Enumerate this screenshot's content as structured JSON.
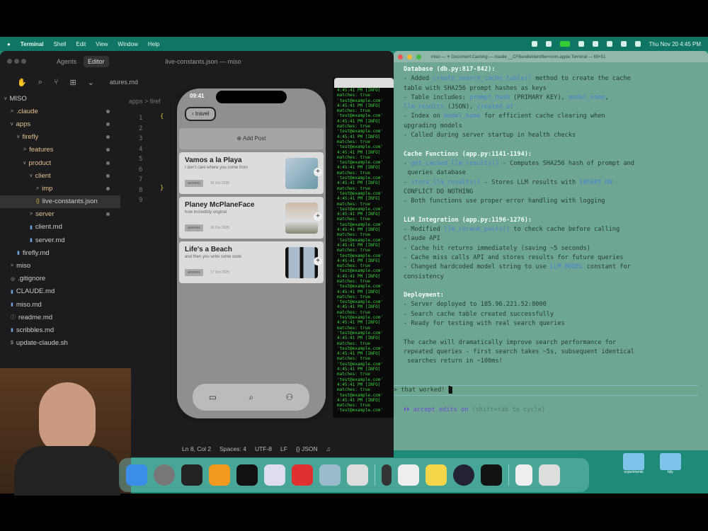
{
  "menubar": {
    "app": "Terminal",
    "items": [
      "Shell",
      "Edit",
      "View",
      "Window",
      "Help"
    ],
    "clock": "Thu Nov 20 4:45 PM"
  },
  "editor": {
    "tabs": [
      "Agents",
      "Editor"
    ],
    "title": "live-constants.json — miso",
    "open_tab": "atures.md",
    "breadcrumb": "apps > firef",
    "tree": [
      {
        "label": "MISO",
        "indent": 0,
        "icon": "v",
        "type": "root"
      },
      {
        "label": ".claude",
        "indent": 1,
        "icon": ">",
        "type": "folder"
      },
      {
        "label": "apps",
        "indent": 1,
        "icon": "v",
        "type": "folder"
      },
      {
        "label": "firefly",
        "indent": 2,
        "icon": "v",
        "type": "folder"
      },
      {
        "label": "features",
        "indent": 3,
        "icon": ">",
        "type": "folder"
      },
      {
        "label": "product",
        "indent": 3,
        "icon": "v",
        "type": "folder"
      },
      {
        "label": "client",
        "indent": 4,
        "icon": "v",
        "type": "folder"
      },
      {
        "label": "imp",
        "indent": 5,
        "icon": ">",
        "type": "folder"
      },
      {
        "label": "live-constants.json",
        "indent": 5,
        "icon": "{}",
        "type": "file",
        "selected": true
      },
      {
        "label": "server",
        "indent": 4,
        "icon": ">",
        "type": "folder"
      },
      {
        "label": "client.md",
        "indent": 4,
        "icon": "▮",
        "type": "file"
      },
      {
        "label": "server.md",
        "indent": 4,
        "icon": "▮",
        "type": "file"
      },
      {
        "label": "firefly.md",
        "indent": 2,
        "icon": "▮",
        "type": "file"
      },
      {
        "label": "miso",
        "indent": 1,
        "icon": ">",
        "type": "file"
      },
      {
        "label": ".gitignore",
        "indent": 1,
        "icon": "◎",
        "type": "file"
      },
      {
        "label": "CLAUDE.md",
        "indent": 1,
        "icon": "▮",
        "type": "file"
      },
      {
        "label": "miso.md",
        "indent": 1,
        "icon": "▮",
        "type": "file"
      },
      {
        "label": "readme.md",
        "indent": 1,
        "icon": "ⓘ",
        "type": "file"
      },
      {
        "label": "scribbles.md",
        "indent": 1,
        "icon": "▮",
        "type": "file"
      },
      {
        "label": "update-claude.sh",
        "indent": 1,
        "icon": "$",
        "type": "file"
      }
    ],
    "lines": [
      "1",
      "2",
      "3",
      "4",
      "5",
      "6",
      "7",
      "8",
      "9"
    ],
    "brace_open": "{",
    "brace_close": "}",
    "status": [
      "Ln 8, Col 2",
      "Spaces: 4",
      "UTF-8",
      "LF",
      "{} JSON"
    ]
  },
  "log": {
    "lines": [
      "4:45:41 PM [INFO]",
      "matches: true",
      "'test@example.com'"
    ]
  },
  "phone": {
    "time": "09:41",
    "back": "travel",
    "add_post": "Add Post",
    "posts": [
      {
        "title": "Vamos a la Playa",
        "subtitle": "I don't care where you come from",
        "tag": "anomos",
        "date": "16 Oct 2025"
      },
      {
        "title": "Planey McPlaneFace",
        "subtitle": "how incredibly original",
        "tag": "anomos",
        "date": "16 Oct 2025"
      },
      {
        "title": "Life's a Beach",
        "subtitle": "and then you write some code",
        "tag": "anomos",
        "date": "17 Oct 2025"
      }
    ]
  },
  "terminal": {
    "title": "miso — ✳ Document Caching — claude __CFBundleIdentifier=com.apple.Terminal — 69×51",
    "prompt": "> that worked! ",
    "mode": "⏵⏵ accept edits on",
    "mode_hint": " (shift+tab to cycle)"
  },
  "desktop": {
    "folders": [
      "experiments",
      "tidy"
    ]
  }
}
